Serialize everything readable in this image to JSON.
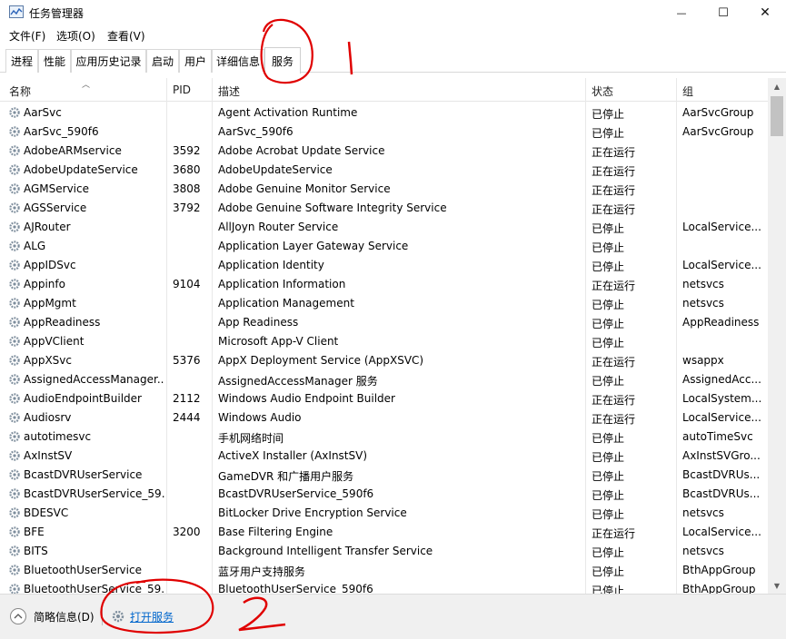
{
  "window": {
    "title": "任务管理器",
    "minimize_glyph": "—",
    "maximize_glyph": "☐",
    "close_glyph": "✕"
  },
  "menu": [
    "文件(F)",
    "选项(O)",
    "查看(V)"
  ],
  "tabs": [
    "进程",
    "性能",
    "应用历史记录",
    "启动",
    "用户",
    "详细信息",
    "服务"
  ],
  "active_tab": "服务",
  "columns": {
    "name": "名称",
    "pid": "PID",
    "desc": "描述",
    "status": "状态",
    "group": "组"
  },
  "rows": [
    {
      "name": "AarSvc",
      "pid": "",
      "desc": "Agent Activation Runtime",
      "status": "已停止",
      "group": "AarSvcGroup"
    },
    {
      "name": "AarSvc_590f6",
      "pid": "",
      "desc": "AarSvc_590f6",
      "status": "已停止",
      "group": "AarSvcGroup"
    },
    {
      "name": "AdobeARMservice",
      "pid": "3592",
      "desc": "Adobe Acrobat Update Service",
      "status": "正在运行",
      "group": ""
    },
    {
      "name": "AdobeUpdateService",
      "pid": "3680",
      "desc": "AdobeUpdateService",
      "status": "正在运行",
      "group": ""
    },
    {
      "name": "AGMService",
      "pid": "3808",
      "desc": "Adobe Genuine Monitor Service",
      "status": "正在运行",
      "group": ""
    },
    {
      "name": "AGSService",
      "pid": "3792",
      "desc": "Adobe Genuine Software Integrity Service",
      "status": "正在运行",
      "group": ""
    },
    {
      "name": "AJRouter",
      "pid": "",
      "desc": "AllJoyn Router Service",
      "status": "已停止",
      "group": "LocalService..."
    },
    {
      "name": "ALG",
      "pid": "",
      "desc": "Application Layer Gateway Service",
      "status": "已停止",
      "group": ""
    },
    {
      "name": "AppIDSvc",
      "pid": "",
      "desc": "Application Identity",
      "status": "已停止",
      "group": "LocalService..."
    },
    {
      "name": "Appinfo",
      "pid": "9104",
      "desc": "Application Information",
      "status": "正在运行",
      "group": "netsvcs"
    },
    {
      "name": "AppMgmt",
      "pid": "",
      "desc": "Application Management",
      "status": "已停止",
      "group": "netsvcs"
    },
    {
      "name": "AppReadiness",
      "pid": "",
      "desc": "App Readiness",
      "status": "已停止",
      "group": "AppReadiness"
    },
    {
      "name": "AppVClient",
      "pid": "",
      "desc": "Microsoft App-V Client",
      "status": "已停止",
      "group": ""
    },
    {
      "name": "AppXSvc",
      "pid": "5376",
      "desc": "AppX Deployment Service (AppXSVC)",
      "status": "正在运行",
      "group": "wsappx"
    },
    {
      "name": "AssignedAccessManager...",
      "pid": "",
      "desc": "AssignedAccessManager 服务",
      "status": "已停止",
      "group": "AssignedAcc..."
    },
    {
      "name": "AudioEndpointBuilder",
      "pid": "2112",
      "desc": "Windows Audio Endpoint Builder",
      "status": "正在运行",
      "group": "LocalSystem..."
    },
    {
      "name": "Audiosrv",
      "pid": "2444",
      "desc": "Windows Audio",
      "status": "正在运行",
      "group": "LocalService..."
    },
    {
      "name": "autotimesvc",
      "pid": "",
      "desc": "手机网络时间",
      "status": "已停止",
      "group": "autoTimeSvc"
    },
    {
      "name": "AxInstSV",
      "pid": "",
      "desc": "ActiveX Installer (AxInstSV)",
      "status": "已停止",
      "group": "AxInstSVGro..."
    },
    {
      "name": "BcastDVRUserService",
      "pid": "",
      "desc": "GameDVR 和广播用户服务",
      "status": "已停止",
      "group": "BcastDVRUs..."
    },
    {
      "name": "BcastDVRUserService_59...",
      "pid": "",
      "desc": "BcastDVRUserService_590f6",
      "status": "已停止",
      "group": "BcastDVRUs..."
    },
    {
      "name": "BDESVC",
      "pid": "",
      "desc": "BitLocker Drive Encryption Service",
      "status": "已停止",
      "group": "netsvcs"
    },
    {
      "name": "BFE",
      "pid": "3200",
      "desc": "Base Filtering Engine",
      "status": "正在运行",
      "group": "LocalService..."
    },
    {
      "name": "BITS",
      "pid": "",
      "desc": "Background Intelligent Transfer Service",
      "status": "已停止",
      "group": "netsvcs"
    },
    {
      "name": "BluetoothUserService",
      "pid": "",
      "desc": "蓝牙用户支持服务",
      "status": "已停止",
      "group": "BthAppGroup"
    },
    {
      "name": "BluetoothUserService_59...",
      "pid": "",
      "desc": "BluetoothUserService_590f6",
      "status": "已停止",
      "group": "BthAppGroup"
    }
  ],
  "footer": {
    "fewer_details": "简略信息(D)",
    "open_services": "打开服务"
  },
  "annotations": [
    "1",
    "2"
  ],
  "colors": {
    "link": "#0066cc",
    "annotation": "#e00000",
    "gear": "#7d8d9c"
  }
}
